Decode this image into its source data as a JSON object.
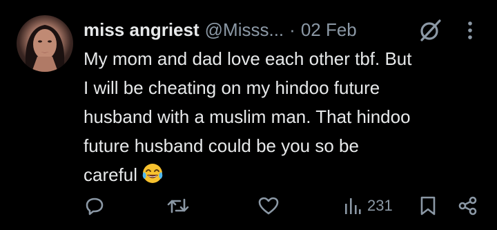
{
  "tweet": {
    "author_name": "miss angriest",
    "handle": "@Misss...",
    "separator": "·",
    "date": "02 Feb",
    "text_lines": [
      "My mom and dad love each other tbf. But",
      "I will be cheating on my hindoo future",
      "husband with a muslim man. That hindoo",
      "future husband could be you so be",
      "careful"
    ],
    "emoji": "face-with-tears-of-joy"
  },
  "actions": {
    "reply_icon": "reply-icon",
    "retweet_icon": "retweet-icon",
    "like_icon": "heart-icon",
    "views_icon": "views-chart-icon",
    "views_count": "231",
    "bookmark_icon": "bookmark-icon",
    "share_icon": "share-icon"
  },
  "colors": {
    "background": "#000000",
    "primary_text": "#e7e9ea",
    "secondary_text": "#8b98a5"
  }
}
